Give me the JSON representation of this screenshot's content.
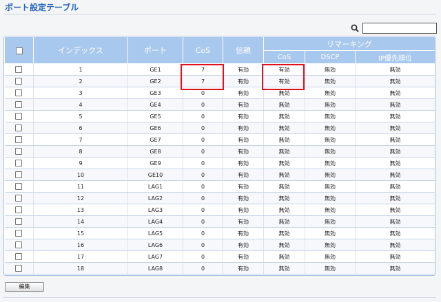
{
  "page": {
    "title": "ポート設定テーブル"
  },
  "search": {
    "value": "",
    "placeholder": ""
  },
  "table": {
    "headers": {
      "index": "インデックス",
      "port": "ポート",
      "cos": "CoS",
      "trust": "信頼",
      "remarking": "リマーキング",
      "remark_cos": "CoS",
      "remark_dscp": "DSCP",
      "remark_ip": "IP優先順位"
    },
    "rows": [
      {
        "index": "1",
        "port": "GE1",
        "cos": "7",
        "trust": "有効",
        "rcos": "有効",
        "dscp": "無効",
        "ip": "無効"
      },
      {
        "index": "2",
        "port": "GE2",
        "cos": "7",
        "trust": "有効",
        "rcos": "有効",
        "dscp": "無効",
        "ip": "無効"
      },
      {
        "index": "3",
        "port": "GE3",
        "cos": "0",
        "trust": "有効",
        "rcos": "無効",
        "dscp": "無効",
        "ip": "無効"
      },
      {
        "index": "4",
        "port": "GE4",
        "cos": "0",
        "trust": "有効",
        "rcos": "無効",
        "dscp": "無効",
        "ip": "無効"
      },
      {
        "index": "5",
        "port": "GE5",
        "cos": "0",
        "trust": "有効",
        "rcos": "無効",
        "dscp": "無効",
        "ip": "無効"
      },
      {
        "index": "6",
        "port": "GE6",
        "cos": "0",
        "trust": "有効",
        "rcos": "無効",
        "dscp": "無効",
        "ip": "無効"
      },
      {
        "index": "7",
        "port": "GE7",
        "cos": "0",
        "trust": "有効",
        "rcos": "無効",
        "dscp": "無効",
        "ip": "無効"
      },
      {
        "index": "8",
        "port": "GE8",
        "cos": "0",
        "trust": "有効",
        "rcos": "無効",
        "dscp": "無効",
        "ip": "無効"
      },
      {
        "index": "9",
        "port": "GE9",
        "cos": "0",
        "trust": "有効",
        "rcos": "無効",
        "dscp": "無効",
        "ip": "無効"
      },
      {
        "index": "10",
        "port": "GE10",
        "cos": "0",
        "trust": "有効",
        "rcos": "無効",
        "dscp": "無効",
        "ip": "無効"
      },
      {
        "index": "11",
        "port": "LAG1",
        "cos": "0",
        "trust": "有効",
        "rcos": "無効",
        "dscp": "無効",
        "ip": "無効"
      },
      {
        "index": "12",
        "port": "LAG2",
        "cos": "0",
        "trust": "有効",
        "rcos": "無効",
        "dscp": "無効",
        "ip": "無効"
      },
      {
        "index": "13",
        "port": "LAG3",
        "cos": "0",
        "trust": "有効",
        "rcos": "無効",
        "dscp": "無効",
        "ip": "無効"
      },
      {
        "index": "14",
        "port": "LAG4",
        "cos": "0",
        "trust": "有効",
        "rcos": "無効",
        "dscp": "無効",
        "ip": "無効"
      },
      {
        "index": "15",
        "port": "LAG5",
        "cos": "0",
        "trust": "有効",
        "rcos": "無効",
        "dscp": "無効",
        "ip": "無効"
      },
      {
        "index": "16",
        "port": "LAG6",
        "cos": "0",
        "trust": "有効",
        "rcos": "無効",
        "dscp": "無効",
        "ip": "無効"
      },
      {
        "index": "17",
        "port": "LAG7",
        "cos": "0",
        "trust": "有効",
        "rcos": "無効",
        "dscp": "無効",
        "ip": "無効"
      },
      {
        "index": "18",
        "port": "LAG8",
        "cos": "0",
        "trust": "有効",
        "rcos": "無効",
        "dscp": "無効",
        "ip": "無効"
      }
    ]
  },
  "toolbar": {
    "edit_label": "編集"
  },
  "colors": {
    "header_bg": "#a9c8ee",
    "title": "#2a66b8",
    "highlight": "#e0111b"
  }
}
